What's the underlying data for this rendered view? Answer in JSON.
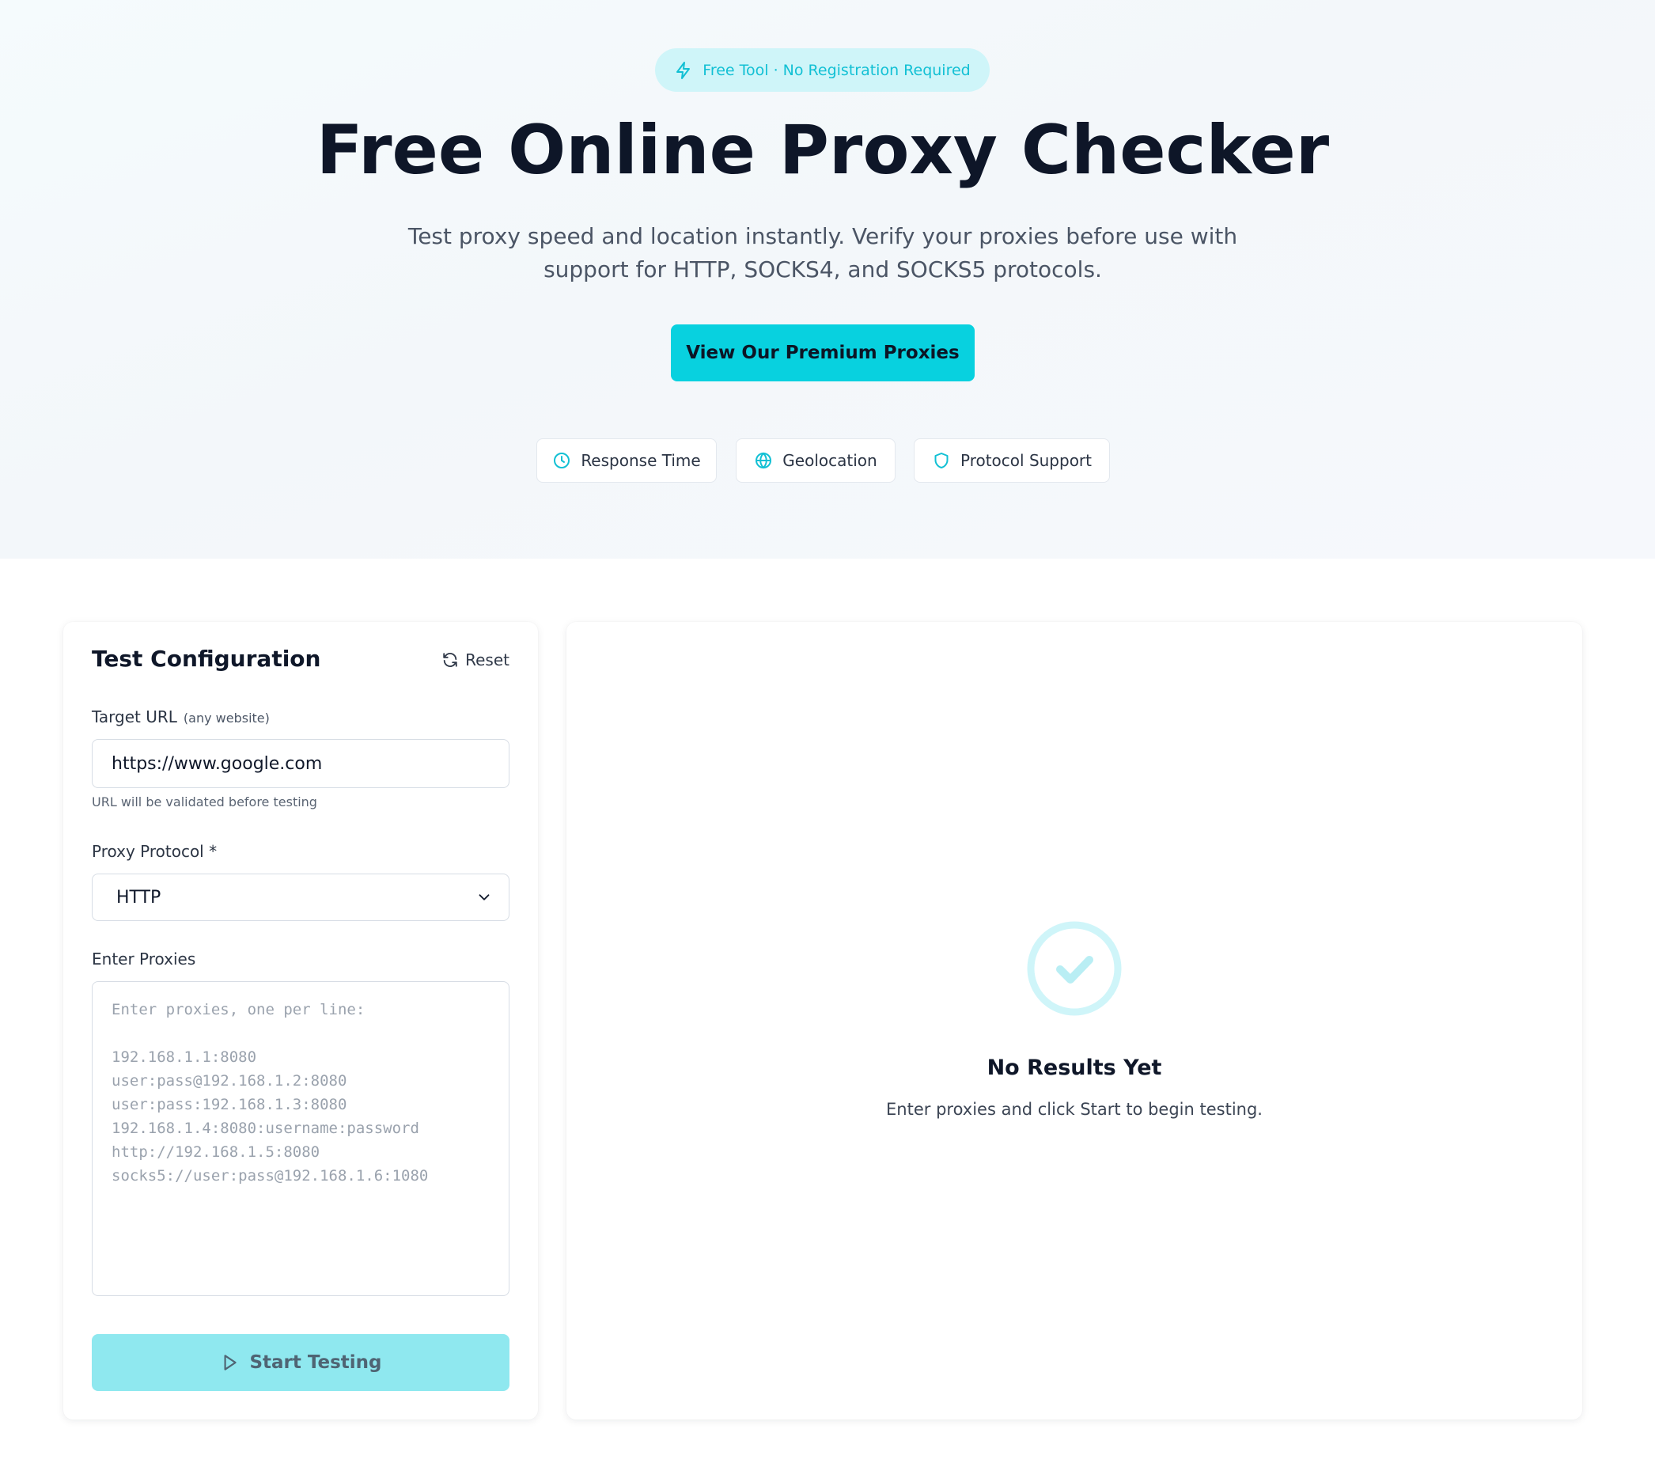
{
  "hero": {
    "badge": "Free Tool · No Registration Required",
    "title": "Free Online Proxy Checker",
    "subtitle": "Test proxy speed and location instantly. Verify your proxies before use with support for HTTP, SOCKS4, and SOCKS5 protocols.",
    "cta_label": "View Our Premium Proxies",
    "features": [
      {
        "label": "Response Time",
        "icon": "clock-icon"
      },
      {
        "label": "Geolocation",
        "icon": "globe-icon"
      },
      {
        "label": "Protocol Support",
        "icon": "shield-icon"
      }
    ]
  },
  "config": {
    "title": "Test Configuration",
    "reset_label": "Reset",
    "target_url_label": "Target URL",
    "target_url_hint": "(any website)",
    "target_url_value": "https://www.google.com",
    "target_url_help": "URL will be validated before testing",
    "protocol_label": "Proxy Protocol *",
    "protocol_value": "HTTP",
    "proxies_label": "Enter Proxies",
    "proxies_placeholder": "Enter proxies, one per line:\n\n192.168.1.1:8080\nuser:pass@192.168.1.2:8080\nuser:pass:192.168.1.3:8080\n192.168.1.4:8080:username:password\nhttp://192.168.1.5:8080\nsocks5://user:pass@192.168.1.6:1080",
    "start_label": "Start Testing"
  },
  "results": {
    "empty_title": "No Results Yet",
    "empty_text": "Enter proxies and click Start to begin testing."
  },
  "colors": {
    "accent": "#08d1df",
    "accent_light": "#cff5f9",
    "disabled_button": "#8fe8ef",
    "text_dark": "#0f1729"
  }
}
